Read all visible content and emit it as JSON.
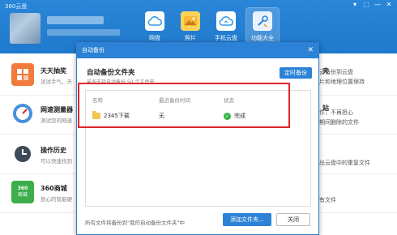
{
  "app": {
    "title": "360云盘"
  },
  "window_controls": [
    "▾",
    "⬚",
    "—",
    "✕"
  ],
  "nav": [
    {
      "label": "网盘",
      "icon": "cloud-icon",
      "color": "#3a9be8"
    },
    {
      "label": "照片",
      "icon": "photo-icon",
      "color": "#f2a93b"
    },
    {
      "label": "手机云盘",
      "icon": "phone-cloud-icon",
      "color": "#3a9be8"
    },
    {
      "label": "功能大全",
      "icon": "tools-icon",
      "color": "#5aa2e0"
    }
  ],
  "tools": [
    {
      "title": "天天抽奖",
      "desc": "试试手气，天",
      "icon": "lottery-icon",
      "color": "#f07b3d"
    },
    {
      "title": "网速测量器",
      "desc": "测试您的网速",
      "icon": "speedometer-icon",
      "color": "#4a90d9"
    },
    {
      "title": "操作历史",
      "desc": "可以快速找到",
      "icon": "clock-icon",
      "color": "#3e4a57"
    },
    {
      "title": "360商城",
      "desc": "放心的智能硬",
      "icon": "store-icon",
      "color": "#3cae4a"
    }
  ],
  "right_column": [
    {
      "title": "夹",
      "desc": "云备份到云盘"
    },
    {
      "title": "",
      "desc": "片和地理位置保持"
    },
    {
      "title": "站",
      "desc": "件，不再担心"
    },
    {
      "title": "",
      "desc": "期间删除的文件"
    },
    {
      "title": "",
      "desc": "出云盘中的重复文件"
    },
    {
      "title": "",
      "desc": "有文件"
    }
  ],
  "dialog": {
    "title": "自动备份",
    "close": "✕",
    "heading": "自动备份文件夹",
    "subtitle": "最多支持自动备份 50 个文件夹",
    "schedule_button": "定时备份",
    "columns": [
      "名称",
      "最近备份时间",
      "状态"
    ],
    "rows": [
      {
        "name": "2345下载",
        "last_backup": "无",
        "status": "完成"
      }
    ],
    "footer_note": "所有文件将备份到\"我的自动备份文件夹\"中",
    "add_folder_button": "添加文件夹...",
    "close_button": "关闭"
  }
}
